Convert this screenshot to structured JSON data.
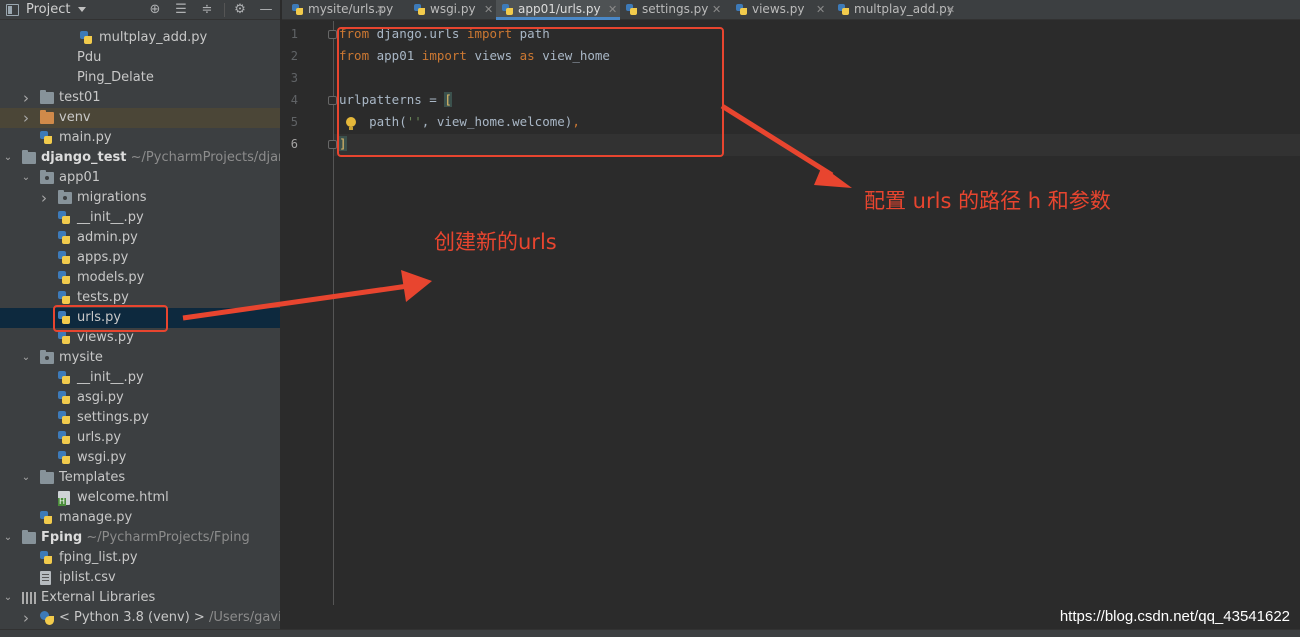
{
  "project_panel": {
    "title": "Project",
    "tree": [
      {
        "label": "multplay_add.py",
        "icon": "python-file-icon",
        "indent": 80,
        "arrow": ""
      },
      {
        "label": "Pdu",
        "icon": "none",
        "indent": 60,
        "arrow": ""
      },
      {
        "label": "Ping_Delate",
        "icon": "none",
        "indent": 60,
        "arrow": ""
      },
      {
        "label": "test01",
        "icon": "folder-icon",
        "indent": 40,
        "arrow": "right"
      },
      {
        "label": "venv",
        "icon": "folder-orange-icon",
        "indent": 40,
        "arrow": "right",
        "row": "highlight"
      },
      {
        "label": "main.py",
        "icon": "python-file-icon",
        "indent": 40,
        "arrow": ""
      },
      {
        "label": "django_test",
        "hint": " ~/PycharmProjects/django",
        "icon": "folder-icon",
        "indent": 22,
        "arrow": "down",
        "bold": true
      },
      {
        "label": "app01",
        "icon": "package-icon",
        "indent": 40,
        "arrow": "down"
      },
      {
        "label": "migrations",
        "icon": "package-icon",
        "indent": 58,
        "arrow": "right"
      },
      {
        "label": "__init__.py",
        "icon": "python-file-icon",
        "indent": 58,
        "arrow": ""
      },
      {
        "label": "admin.py",
        "icon": "python-file-icon",
        "indent": 58,
        "arrow": ""
      },
      {
        "label": "apps.py",
        "icon": "python-file-icon",
        "indent": 58,
        "arrow": ""
      },
      {
        "label": "models.py",
        "icon": "python-file-icon",
        "indent": 58,
        "arrow": ""
      },
      {
        "label": "tests.py",
        "icon": "python-file-icon",
        "indent": 58,
        "arrow": ""
      },
      {
        "label": "urls.py",
        "icon": "python-file-icon",
        "indent": 58,
        "arrow": "",
        "row": "selected"
      },
      {
        "label": "views.py",
        "icon": "python-file-icon",
        "indent": 58,
        "arrow": ""
      },
      {
        "label": "mysite",
        "icon": "package-icon",
        "indent": 40,
        "arrow": "down"
      },
      {
        "label": "__init__.py",
        "icon": "python-file-icon",
        "indent": 58,
        "arrow": ""
      },
      {
        "label": "asgi.py",
        "icon": "python-file-icon",
        "indent": 58,
        "arrow": ""
      },
      {
        "label": "settings.py",
        "icon": "python-file-icon",
        "indent": 58,
        "arrow": ""
      },
      {
        "label": "urls.py",
        "icon": "python-file-icon",
        "indent": 58,
        "arrow": ""
      },
      {
        "label": "wsgi.py",
        "icon": "python-file-icon",
        "indent": 58,
        "arrow": ""
      },
      {
        "label": "Templates",
        "icon": "folder-icon",
        "indent": 40,
        "arrow": "down"
      },
      {
        "label": "welcome.html",
        "icon": "html-file-icon",
        "indent": 58,
        "arrow": ""
      },
      {
        "label": "manage.py",
        "icon": "python-file-icon",
        "indent": 40,
        "arrow": ""
      },
      {
        "label": "Fping",
        "hint": " ~/PycharmProjects/Fping",
        "icon": "folder-icon",
        "indent": 22,
        "arrow": "down",
        "bold": true
      },
      {
        "label": "fping_list.py",
        "icon": "python-file-icon",
        "indent": 40,
        "arrow": ""
      },
      {
        "label": "iplist.csv",
        "icon": "csv-file-icon",
        "indent": 40,
        "arrow": ""
      },
      {
        "label": "External Libraries",
        "icon": "library-icon",
        "indent": 22,
        "arrow": "down"
      },
      {
        "label": "< Python 3.8 (venv) >",
        "hint": " /Users/gavinw",
        "icon": "python-sdk-icon",
        "indent": 40,
        "arrow": "right"
      }
    ]
  },
  "tabs": [
    {
      "label": "mysite/urls.py",
      "active": false
    },
    {
      "label": "wsgi.py",
      "active": false
    },
    {
      "label": "app01/urls.py",
      "active": true
    },
    {
      "label": "settings.py",
      "active": false
    },
    {
      "label": "views.py",
      "active": false
    },
    {
      "label": "multplay_add.py",
      "active": false
    }
  ],
  "editor": {
    "line_numbers": [
      "1",
      "2",
      "3",
      "4",
      "5",
      "6"
    ],
    "current_line": 6,
    "lines": [
      [
        {
          "t": "from",
          "c": "kw"
        },
        {
          "t": " django.urls ",
          "c": ""
        },
        {
          "t": "import",
          "c": "kw"
        },
        {
          "t": " path",
          "c": ""
        }
      ],
      [
        {
          "t": "from",
          "c": "kw"
        },
        {
          "t": " app01 ",
          "c": ""
        },
        {
          "t": "import",
          "c": "kw"
        },
        {
          "t": " views ",
          "c": ""
        },
        {
          "t": "as",
          "c": "kw"
        },
        {
          "t": " view_home",
          "c": ""
        }
      ],
      [],
      [
        {
          "t": "urlpatterns = ",
          "c": ""
        },
        {
          "t": "[",
          "c": "brk"
        }
      ],
      [
        {
          "t": "    path(",
          "c": ""
        },
        {
          "t": "''",
          "c": "str"
        },
        {
          "t": ", view_home.welcome)",
          "c": ""
        },
        {
          "t": ",",
          "c": "kw"
        }
      ],
      [
        {
          "t": "]",
          "c": "brk"
        }
      ]
    ]
  },
  "annotations": {
    "create_urls": "创建新的urls",
    "configure_urls": "配置 urls 的路径 h 和参数",
    "color": "#e8452f"
  },
  "watermark": "https://blog.csdn.net/qq_43541622"
}
